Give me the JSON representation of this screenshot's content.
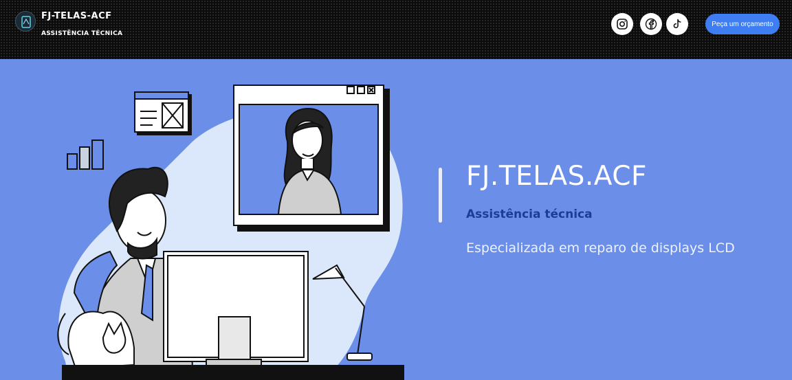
{
  "header": {
    "brand": "FJ-TELAS-ACF",
    "tagline": "ASSISTÊNCIA TÉCNICA",
    "cta_label": "Peça um orçamento",
    "social": [
      "instagram-icon",
      "facebook-icon",
      "tiktok-icon"
    ]
  },
  "hero": {
    "title": "FJ.TELAS.ACF",
    "subtitle": "Assistência técnica",
    "description": "Especializada em reparo de displays LCD"
  },
  "colors": {
    "header_bg": "#0b0b0b",
    "hero_bg": "#6b8fe8",
    "cta_bg": "#3f7ef2",
    "subtitle": "#1c3c96"
  }
}
